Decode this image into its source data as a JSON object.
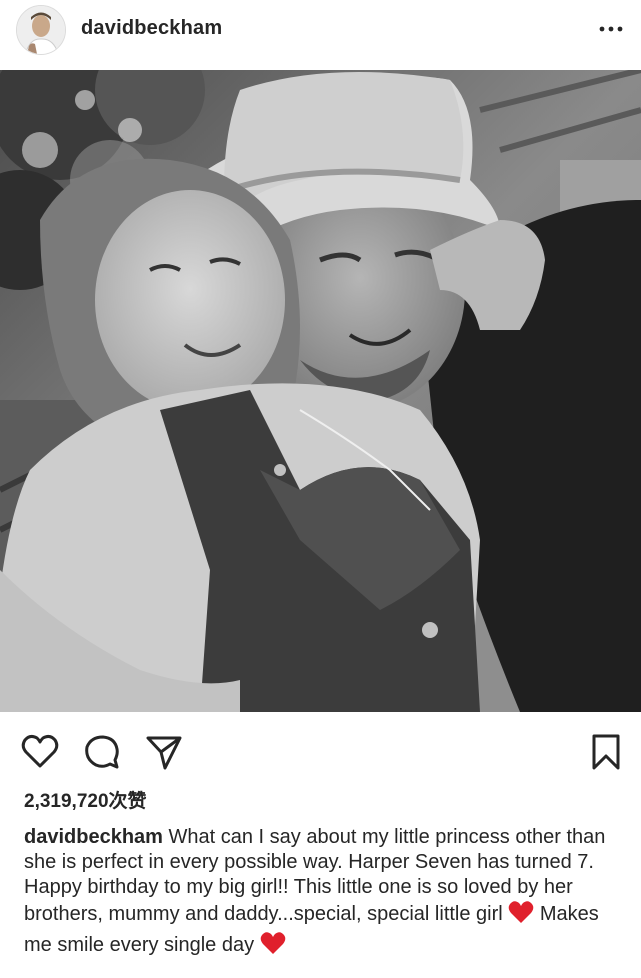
{
  "post": {
    "username": "davidbeckham",
    "likes_text": "2,319,720次赞",
    "caption_user": "davidbeckham",
    "caption_part1": " What can I say about my little princess other than she is perfect in every possible way. Harper Seven has turned 7. Happy birthday to my big girl!! This little one is so loved by her brothers, mummy and daddy...special, special little girl ",
    "caption_part2": " Makes me smile every single day ",
    "photo_description": "black-and-white selfie photo"
  },
  "icons": {
    "more": "more-options-icon",
    "like": "heart-icon",
    "comment": "comment-icon",
    "share": "send-icon",
    "save": "bookmark-icon",
    "emoji": "red-heart-emoji"
  },
  "colors": {
    "text": "#262626",
    "emoji_red": "#e0202c",
    "divider": "#dbdbdb"
  }
}
